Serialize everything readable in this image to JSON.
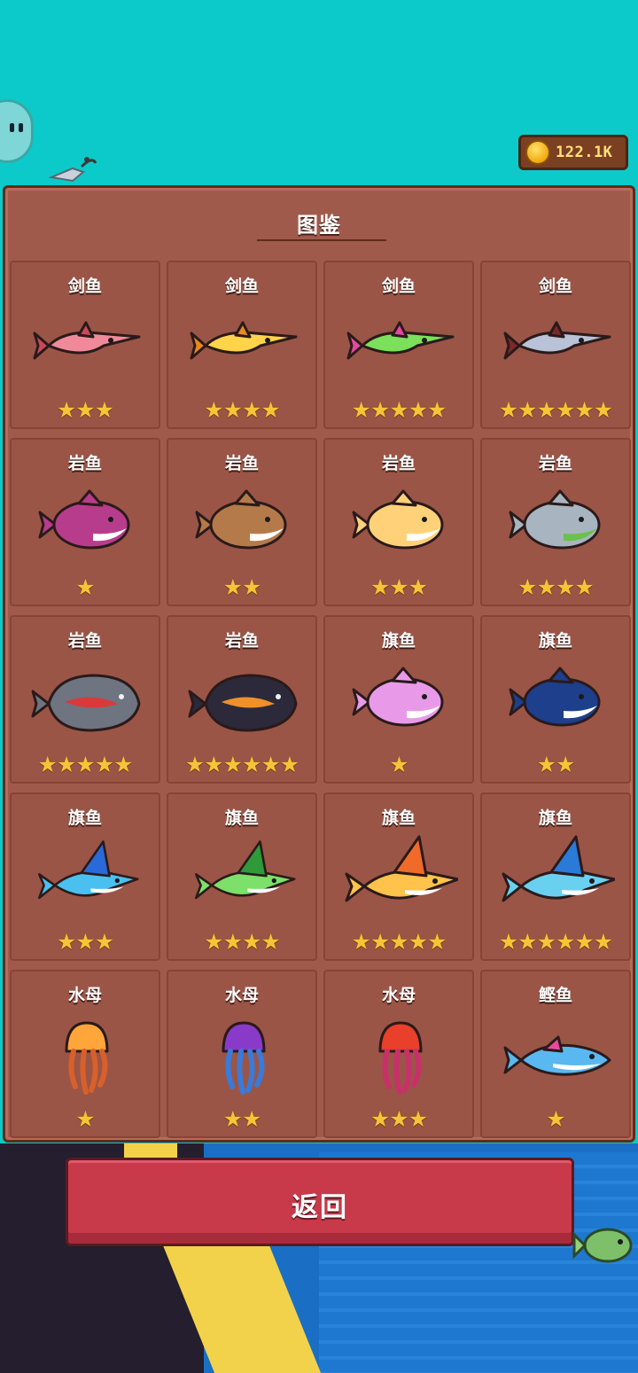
{
  "currency": {
    "amount": "122.1K",
    "icon": "coin-icon"
  },
  "panel": {
    "title": "图鉴"
  },
  "cards": [
    {
      "name": "剑鱼",
      "stars": 3,
      "shape": "sword",
      "c1": "#f08a9a",
      "c2": "#c94a5a"
    },
    {
      "name": "剑鱼",
      "stars": 4,
      "shape": "sword",
      "c1": "#ffd34a",
      "c2": "#e68a1e"
    },
    {
      "name": "剑鱼",
      "stars": 5,
      "shape": "sword",
      "c1": "#7be05a",
      "c2": "#e24aa0"
    },
    {
      "name": "剑鱼",
      "stars": 6,
      "shape": "sword",
      "c1": "#b9c2d6",
      "c2": "#7a2a2a"
    },
    {
      "name": "岩鱼",
      "stars": 1,
      "shape": "round",
      "c1": "#b83c8c",
      "c2": "#ffffff"
    },
    {
      "name": "岩鱼",
      "stars": 2,
      "shape": "round",
      "c1": "#b57a4a",
      "c2": "#ffffff"
    },
    {
      "name": "岩鱼",
      "stars": 3,
      "shape": "round",
      "c1": "#ffd27a",
      "c2": "#ffffff"
    },
    {
      "name": "岩鱼",
      "stars": 4,
      "shape": "round",
      "c1": "#a8b4c0",
      "c2": "#6ac24a"
    },
    {
      "name": "岩鱼",
      "stars": 5,
      "shape": "rock",
      "c1": "#6e7480",
      "c2": "#d83a3a"
    },
    {
      "name": "岩鱼",
      "stars": 6,
      "shape": "rock",
      "c1": "#2c2a3a",
      "c2": "#f0902a"
    },
    {
      "name": "旗鱼",
      "stars": 1,
      "shape": "round",
      "c1": "#e89ae8",
      "c2": "#ffffff"
    },
    {
      "name": "旗鱼",
      "stars": 2,
      "shape": "round",
      "c1": "#1d3f8c",
      "c2": "#ffffff"
    },
    {
      "name": "旗鱼",
      "stars": 3,
      "shape": "sail",
      "c1": "#4ac0f0",
      "c2": "#2a6ad8"
    },
    {
      "name": "旗鱼",
      "stars": 4,
      "shape": "sail",
      "c1": "#7ce06a",
      "c2": "#2f9a3a"
    },
    {
      "name": "旗鱼",
      "stars": 5,
      "shape": "sailbig",
      "c1": "#ffc24a",
      "c2": "#f06a2a"
    },
    {
      "name": "旗鱼",
      "stars": 6,
      "shape": "sailbig",
      "c1": "#6ad0f0",
      "c2": "#2a7ad8"
    },
    {
      "name": "水母",
      "stars": 1,
      "shape": "jelly",
      "c1": "#ffa63a",
      "c2": "#d8602a"
    },
    {
      "name": "水母",
      "stars": 2,
      "shape": "jelly",
      "c1": "#8a3ac8",
      "c2": "#3a7ad8"
    },
    {
      "name": "水母",
      "stars": 3,
      "shape": "jelly",
      "c1": "#e8402a",
      "c2": "#c8306a"
    },
    {
      "name": "鲣鱼",
      "stars": 1,
      "shape": "bonito",
      "c1": "#5ab8f0",
      "c2": "#e84aa0"
    }
  ],
  "back_button": {
    "label": "返回"
  }
}
